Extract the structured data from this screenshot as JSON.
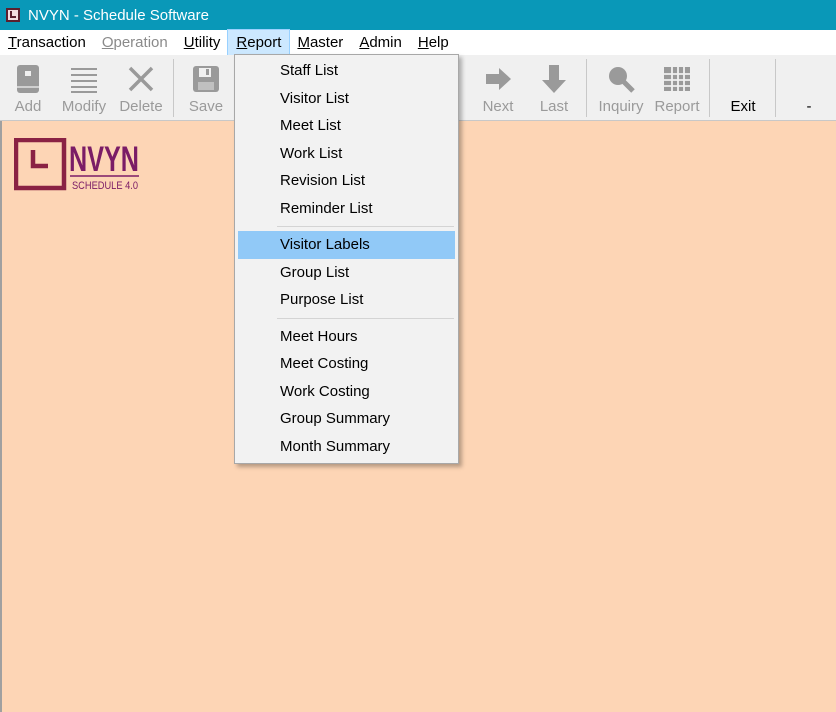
{
  "window": {
    "title": "NVYN - Schedule Software"
  },
  "menubar": {
    "items": [
      {
        "id": "transaction",
        "label": "Transaction",
        "accel": "T",
        "rest": "ransaction",
        "disabled": false
      },
      {
        "id": "operation",
        "label": "Operation",
        "accel": "O",
        "rest": "peration",
        "disabled": true
      },
      {
        "id": "utility",
        "label": "Utility",
        "accel": "U",
        "rest": "tility",
        "disabled": false
      },
      {
        "id": "report",
        "label": "Report",
        "accel": "R",
        "rest": "eport",
        "disabled": false,
        "active": true
      },
      {
        "id": "master",
        "label": "Master",
        "accel": "M",
        "rest": "aster",
        "disabled": false
      },
      {
        "id": "admin",
        "label": "Admin",
        "accel": "A",
        "rest": "dmin",
        "disabled": false
      },
      {
        "id": "help",
        "label": "Help",
        "accel": "H",
        "rest": "elp",
        "disabled": false
      }
    ]
  },
  "toolbar": {
    "add_label": "Add",
    "modify_label": "Modify",
    "delete_label": "Delete",
    "save_label": "Save",
    "next_label": "Next",
    "last_label": "Last",
    "inquiry_label": "Inquiry",
    "report_label": "Report",
    "exit_label": "Exit",
    "minimize_label": "-",
    "icons": [
      "book-icon",
      "list-icon",
      "close-x-icon",
      "floppy-disk-icon",
      "arrow-right-icon",
      "arrow-down-icon",
      "magnifier-icon",
      "grid-icon"
    ]
  },
  "logo": {
    "name": "NVYN",
    "subtitle": "SCHEDULE 4.0"
  },
  "report_menu": {
    "groups": [
      [
        "Staff List",
        "Visitor List",
        "Meet List",
        "Work List",
        "Revision List",
        "Reminder List"
      ],
      [
        "Visitor Labels",
        "Group List",
        "Purpose List"
      ],
      [
        "Meet Hours",
        "Meet Costing",
        "Work Costing",
        "Group Summary",
        "Month Summary"
      ]
    ],
    "highlighted": "Visitor Labels"
  },
  "colors": {
    "titlebar": "#0998b8",
    "workspace": "#fdd5b5",
    "menu_highlight": "#91c9f7",
    "logo_purple": "#7b1c66",
    "logo_maroon": "#8a2244"
  }
}
